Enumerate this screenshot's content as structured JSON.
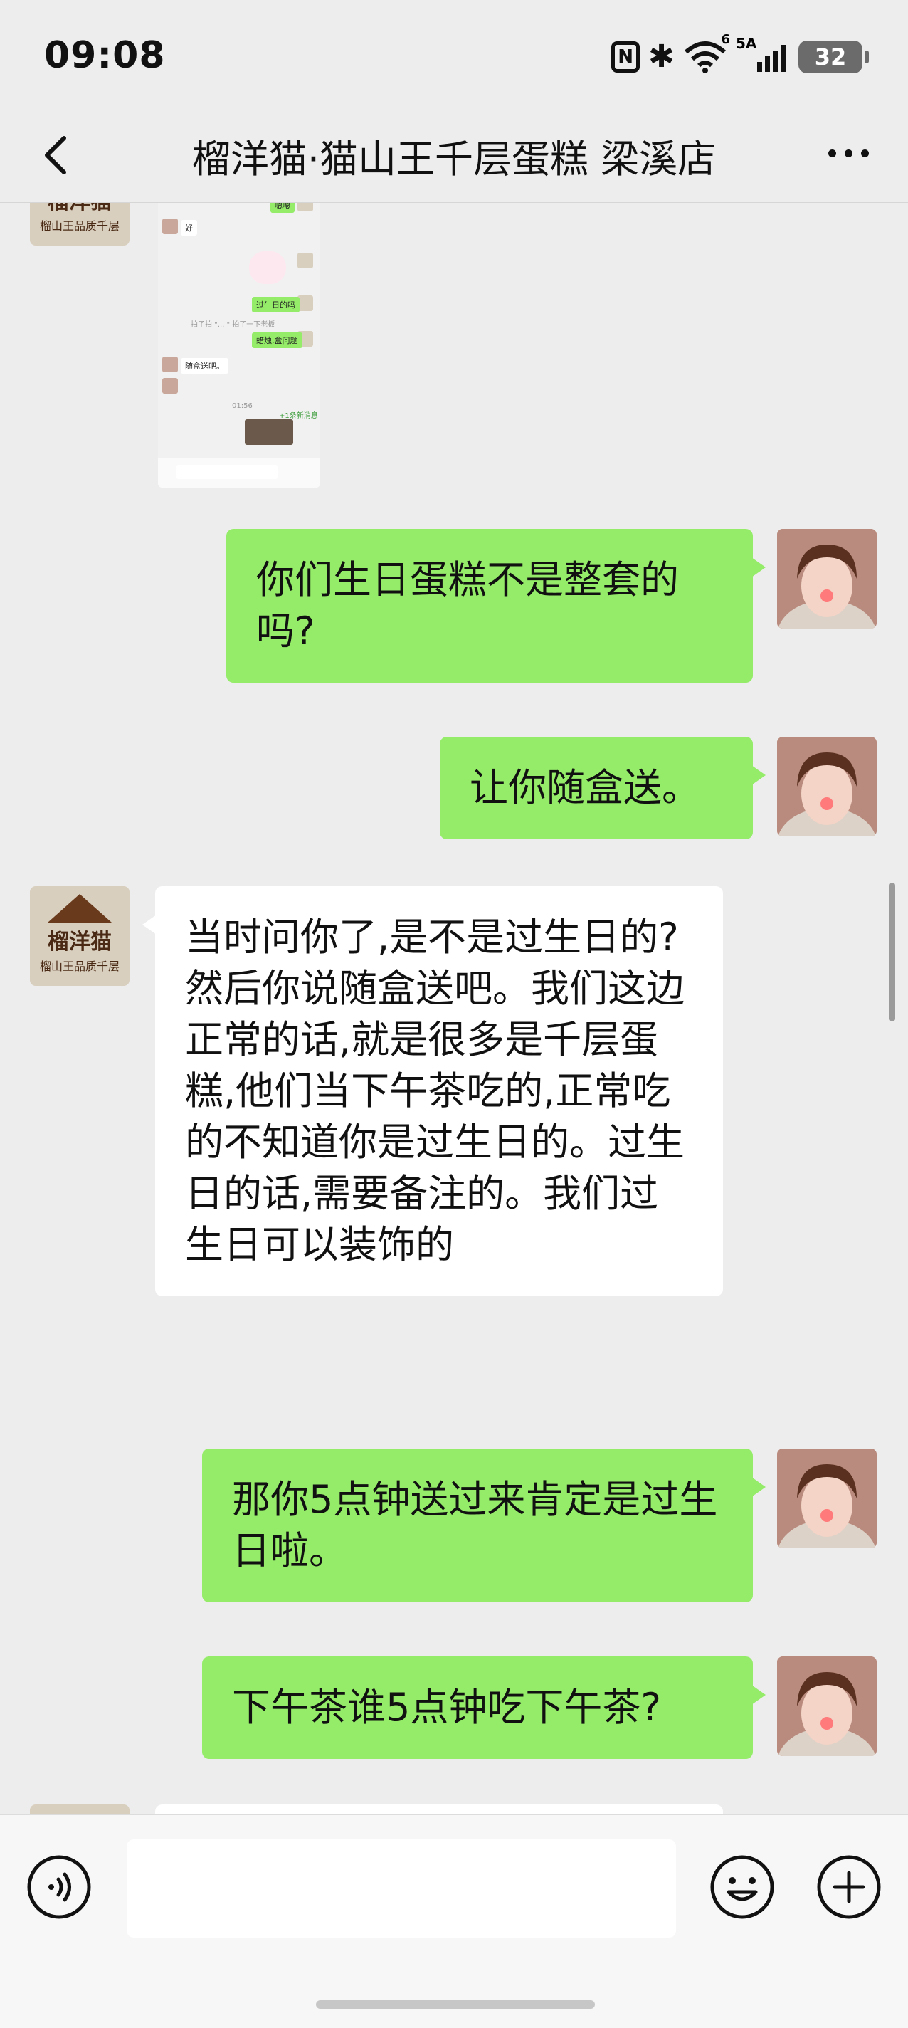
{
  "status_bar": {
    "time": "09:08",
    "nfc": "N",
    "network": "6",
    "signal_label": "5A",
    "battery": "32",
    "icons": [
      "nfc-icon",
      "bluetooth-icon",
      "wifi-icon",
      "cellular-signal-icon",
      "battery-icon"
    ]
  },
  "header": {
    "title": "榴洋猫·猫山王千层蛋糕 梁溪店",
    "back_icon": "chevron-left-icon",
    "more_icon": "more-horizontal-icon"
  },
  "shop_avatar": {
    "name": "榴洋猫",
    "sub": "榴山王品质千层"
  },
  "screenshot_message": {
    "bubbles": [
      {
        "side": "me",
        "text": "嗯嗯"
      },
      {
        "side": "them",
        "text": "好"
      },
      {
        "side": "me",
        "text": "过生日的吗"
      },
      {
        "side": "me",
        "text": "蜡烛,盒问题"
      },
      {
        "side": "them",
        "text": "随盒送吧。"
      }
    ],
    "system_note": "拍了拍 \"... \" 拍了一下老板",
    "time": "01:56",
    "video_badge": "+1条新消息"
  },
  "messages": [
    {
      "side": "me",
      "text": "你们生日蛋糕不是整套的吗?"
    },
    {
      "side": "me",
      "text": "让你随盒送。"
    },
    {
      "side": "them",
      "text": "当时问你了,是不是过生日的?然后你说随盒送吧。我们这边正常的话,就是很多是千层蛋糕,他们当下午茶吃的,正常吃的不知道你是过生日的。过生日的话,需要备注的。我们过生日可以装饰的"
    },
    {
      "side": "me",
      "text": "那你5点钟送过来肯定是过生日啦。"
    },
    {
      "side": "me",
      "text": "下午茶谁5点钟吃下午茶?"
    }
  ],
  "input_bar": {
    "input_value": "",
    "voice_icon": "voice-icon",
    "emoji_icon": "emoji-icon",
    "plus_icon": "plus-icon"
  },
  "colors": {
    "background": "#ededed",
    "my_bubble": "#95ec69",
    "their_bubble": "#ffffff",
    "input_bar": "#f7f7f7"
  }
}
